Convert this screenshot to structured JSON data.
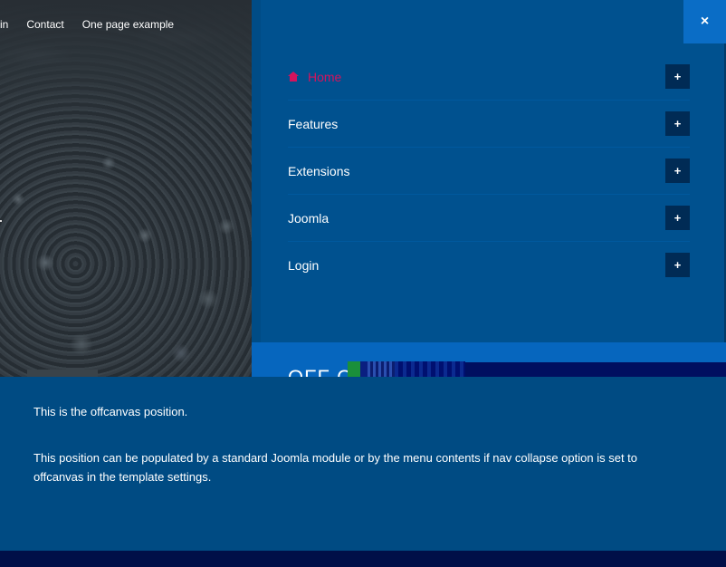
{
  "topnav": {
    "items": [
      "in",
      "Contact",
      "One page example"
    ]
  },
  "close_icon": "×",
  "menu": {
    "items": [
      {
        "label": "Home",
        "active": true,
        "expand_icon": "+"
      },
      {
        "label": "Features",
        "active": false,
        "expand_icon": "+"
      },
      {
        "label": "Extensions",
        "active": false,
        "expand_icon": "+"
      },
      {
        "label": "Joomla",
        "active": false,
        "expand_icon": "+"
      },
      {
        "label": "Login",
        "active": false,
        "expand_icon": "+"
      }
    ]
  },
  "offcanvas": {
    "title": "OFF CA",
    "paragraph_1": "This is the offcanvas position.",
    "paragraph_2": "This position can be populated by a standard Joomla module or by the menu contents if nav collapse option is set to offcanvas in the template settings."
  },
  "colors": {
    "panel": "#00518f",
    "active_link": "#d4135d",
    "close_button": "#0a6dc6",
    "expand_button": "#002b55"
  },
  "icons": {
    "home": "home-icon",
    "close": "close-icon",
    "expand": "plus-icon"
  }
}
